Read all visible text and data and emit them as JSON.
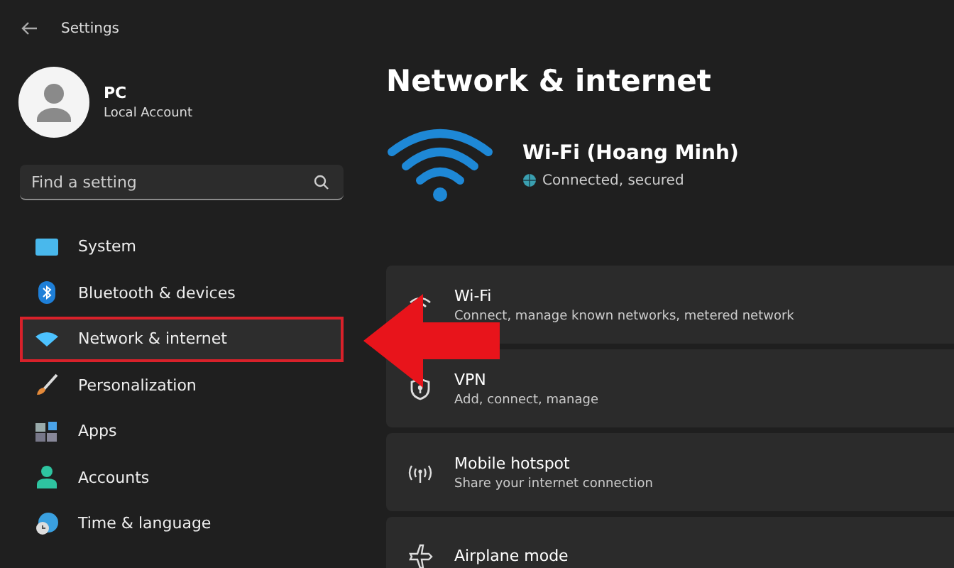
{
  "window": {
    "title": "Settings"
  },
  "account": {
    "name": "PC",
    "type": "Local Account"
  },
  "search": {
    "placeholder": "Find a setting"
  },
  "sidebar": {
    "items": [
      {
        "label": "System",
        "selected": false
      },
      {
        "label": "Bluetooth & devices",
        "selected": false
      },
      {
        "label": "Network & internet",
        "selected": true
      },
      {
        "label": "Personalization",
        "selected": false
      },
      {
        "label": "Apps",
        "selected": false
      },
      {
        "label": "Accounts",
        "selected": false
      },
      {
        "label": "Time & language",
        "selected": false
      }
    ]
  },
  "page": {
    "title": "Network & internet",
    "connection": {
      "name": "Wi-Fi (Hoang Minh)",
      "status": "Connected, secured"
    },
    "cards": [
      {
        "title": "Wi-Fi",
        "subtitle": "Connect, manage known networks, metered network"
      },
      {
        "title": "VPN",
        "subtitle": "Add, connect, manage"
      },
      {
        "title": "Mobile hotspot",
        "subtitle": "Share your internet connection"
      },
      {
        "title": "Airplane mode"
      }
    ]
  }
}
